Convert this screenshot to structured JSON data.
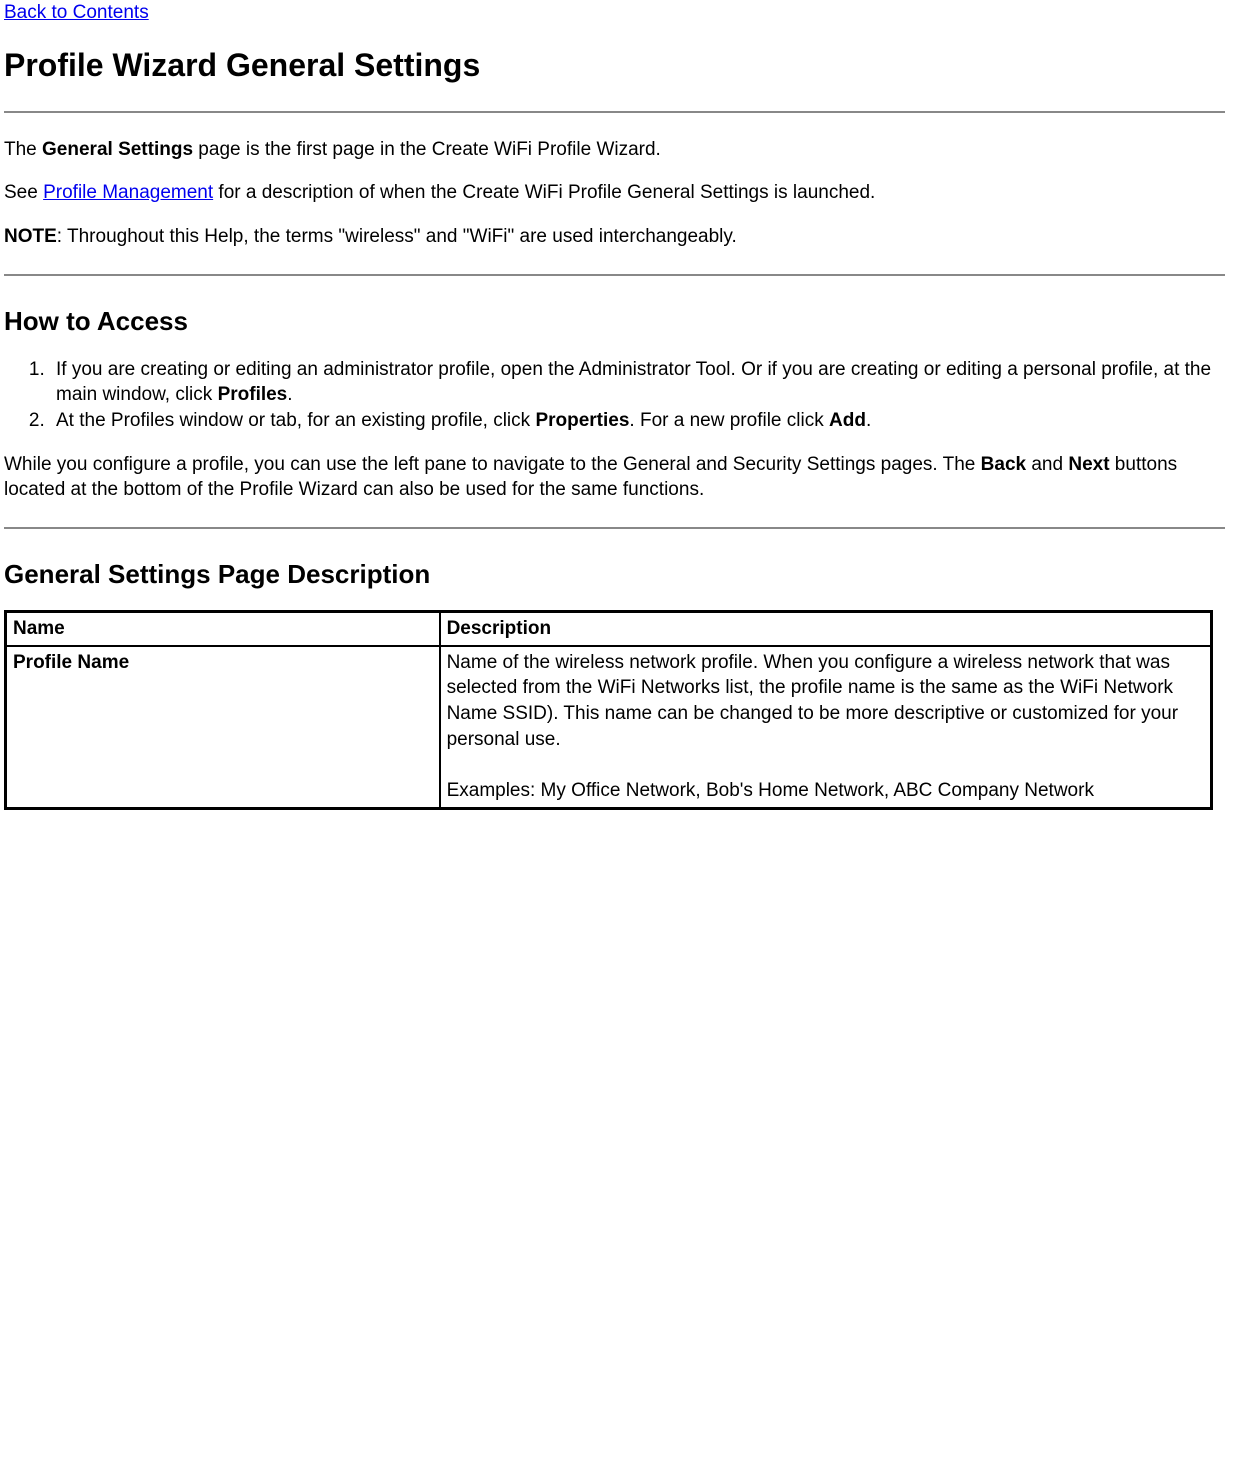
{
  "nav": {
    "back_link": "Back to Contents"
  },
  "title": "Profile Wizard General Settings",
  "intro": {
    "p1_pre": "The ",
    "p1_b": "General Settings",
    "p1_post": " page is the first page in the Create WiFi Profile Wizard.",
    "p2_pre": "See ",
    "p2_link": "Profile Management",
    "p2_post": " for a description of when the Create WiFi Profile General Settings is launched.",
    "note_b": "NOTE",
    "note_post": ": Throughout this Help, the terms \"wireless\" and \"WiFi\" are used interchangeably."
  },
  "section1": {
    "heading": "How to Access",
    "steps": [
      {
        "pre": "If you are creating or editing an administrator profile, open the Administrator Tool. Or if you are creating or editing a personal profile, at the main window, click ",
        "b1": "Profiles",
        "post1": "."
      },
      {
        "pre": "At the Profiles window or tab, for an existing profile, click ",
        "b1": "Properties",
        "mid": ". For a new profile click ",
        "b2": "Add",
        "post": "."
      }
    ],
    "para_pre": "While you configure a profile, you can use the left pane to navigate to the General and Security Settings pages. The ",
    "para_b1": "Back",
    "para_mid": " and ",
    "para_b2": "Next",
    "para_post": " buttons located at the bottom of the Profile Wizard can also be used for the same functions."
  },
  "section2": {
    "heading": "General Settings Page Description",
    "table": {
      "header_name": "Name",
      "header_desc": "Description",
      "row1": {
        "name": "Profile Name",
        "desc_p1": "Name of the wireless network profile. When you configure a wireless network that was selected from the WiFi Networks list, the profile name is the same as the WiFi Network Name SSID). This name can be changed to be more descriptive or customized for your personal use.",
        "desc_p2": "Examples: My Office Network, Bob's Home Network, ABC Company Network"
      }
    }
  }
}
